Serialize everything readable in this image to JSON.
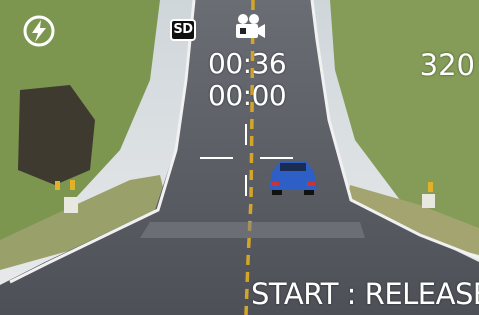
{
  "osd": {
    "flash_icon": "flash-off-icon",
    "media_icon": "sd-card-icon",
    "media_label": "SD",
    "mode_icon": "movie-camera-icon",
    "recordable_time": "00:36",
    "elapsed_time": "00:00",
    "resolution": "320",
    "status": "START : RELEASE"
  },
  "colors": {
    "osd_text": "#ffffff",
    "sky": "#dfe3e6",
    "grass": "#7f9a52",
    "road": "#55585f",
    "car": "#2e5fc7",
    "center_line": "#d3a528"
  }
}
